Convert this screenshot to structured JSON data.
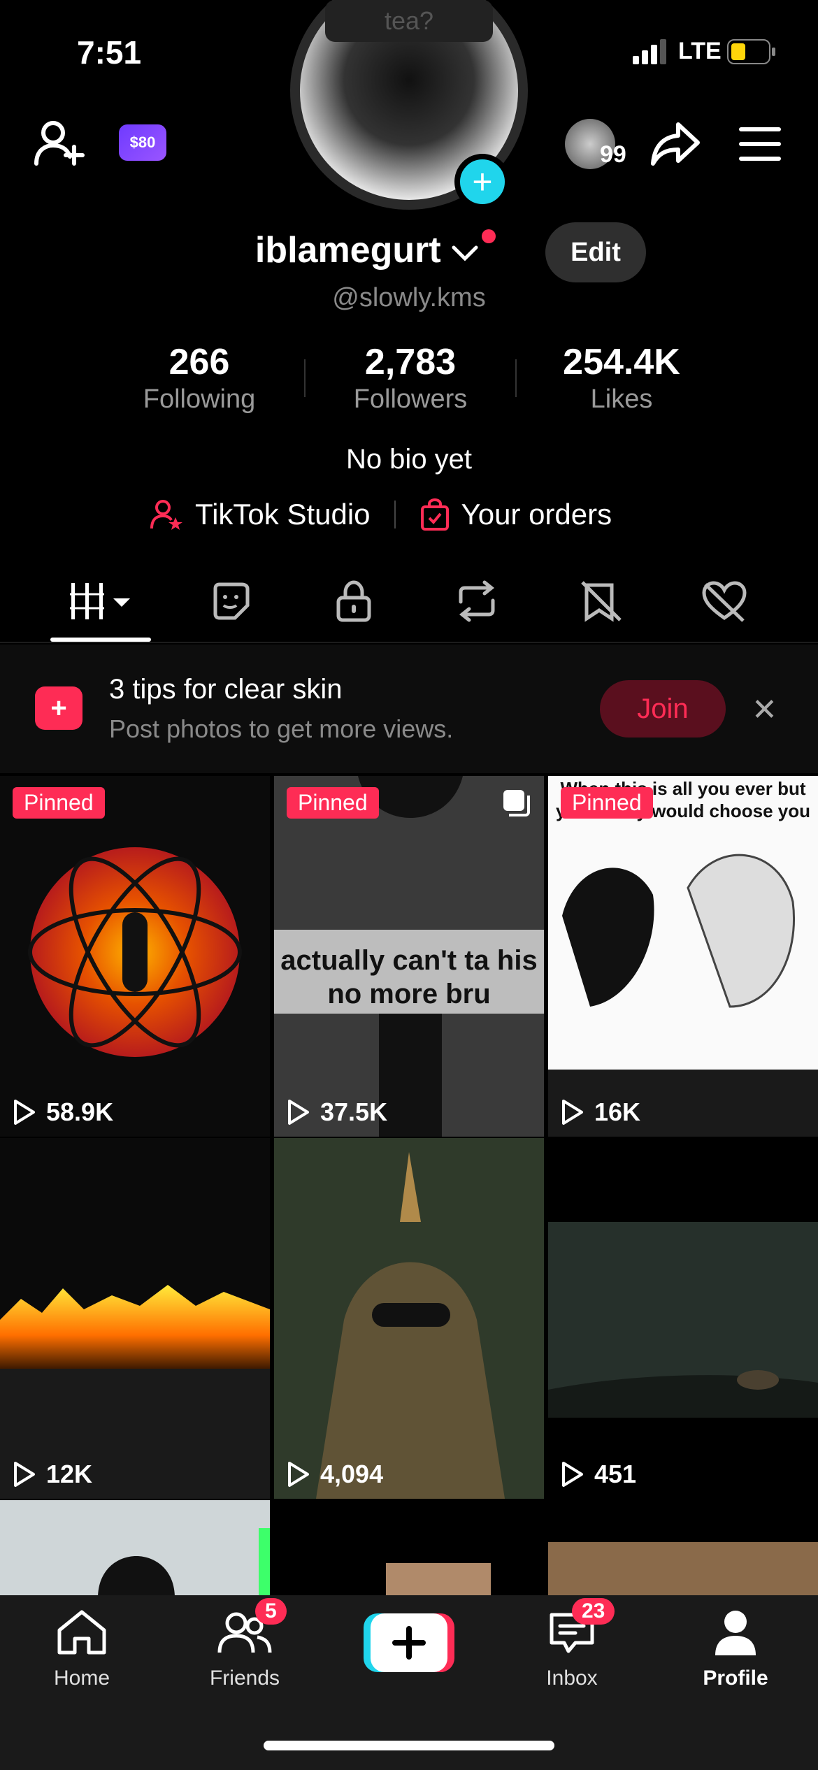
{
  "status": {
    "time": "7:51",
    "network": "LTE"
  },
  "header": {
    "coin_badge": "$80",
    "small_avatar_count": "99"
  },
  "avatar": {
    "tea_text": "tea?"
  },
  "profile": {
    "username": "iblamegurt",
    "handle": "@slowly.kms",
    "edit_label": "Edit",
    "bio": "No bio yet"
  },
  "stats": [
    {
      "value": "266",
      "label": "Following"
    },
    {
      "value": "2,783",
      "label": "Followers"
    },
    {
      "value": "254.4K",
      "label": "Likes"
    }
  ],
  "links": {
    "studio": "TikTok Studio",
    "orders": "Your orders"
  },
  "tabs": [
    "videos-icon",
    "stickers-icon",
    "private-icon",
    "reposts-icon",
    "favorites-icon",
    "liked-icon"
  ],
  "tips": {
    "title": "3 tips for clear skin",
    "subtitle": "Post photos to get more views.",
    "join": "Join"
  },
  "grid": [
    {
      "pinned": "Pinned",
      "views": "58.9K"
    },
    {
      "pinned": "Pinned",
      "views": "37.5K",
      "caption": "actually can't ta his no more bru"
    },
    {
      "pinned": "Pinned",
      "views": "16K",
      "caption": "When this is all you ever but yk nobody would choose you"
    },
    {
      "views": "12K"
    },
    {
      "views": "4,094"
    },
    {
      "views": "451"
    }
  ],
  "nav": {
    "home": "Home",
    "friends": "Friends",
    "friends_badge": "5",
    "inbox": "Inbox",
    "inbox_badge": "23",
    "profile": "Profile"
  },
  "colors": {
    "accent": "#fe2c55",
    "cyan": "#20d5ec",
    "coin": "#7b45ff"
  }
}
